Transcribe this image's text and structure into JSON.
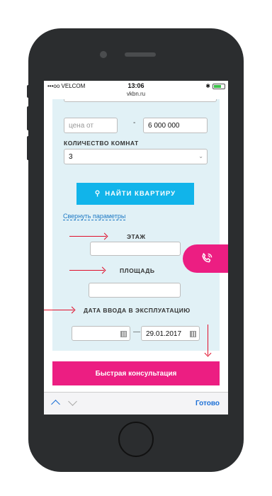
{
  "status_bar": {
    "carrier": "•••oo VELCOM",
    "time": "13:06"
  },
  "browser": {
    "url": "vkbn.ru"
  },
  "form": {
    "price_from_placeholder": "цена от",
    "price_dash": "-",
    "price_to_value": "6 000 000",
    "rooms_label": "КОЛИЧЕСТВО КОМНАТ",
    "rooms_value": "3",
    "find_button": "НАЙТИ КВАРТИРУ",
    "collapse_link": "Свернуть параметры",
    "floor_label": "ЭТАЖ",
    "area_label": "ПЛОЩАДЬ",
    "commission_label": "ДАТА ВВОДА В ЭКСПЛУАТАЦИЮ",
    "date_dash": "—",
    "date_to_value": "29.01.2017",
    "consult_button": "Быстрая консультация"
  },
  "keyboard_bar": {
    "done_label": "Готово"
  },
  "colors": {
    "accent_pink": "#ec1e82",
    "accent_blue": "#11b4ea",
    "arrow_red": "#e0102c",
    "panel_bg": "#e1f1f6"
  }
}
